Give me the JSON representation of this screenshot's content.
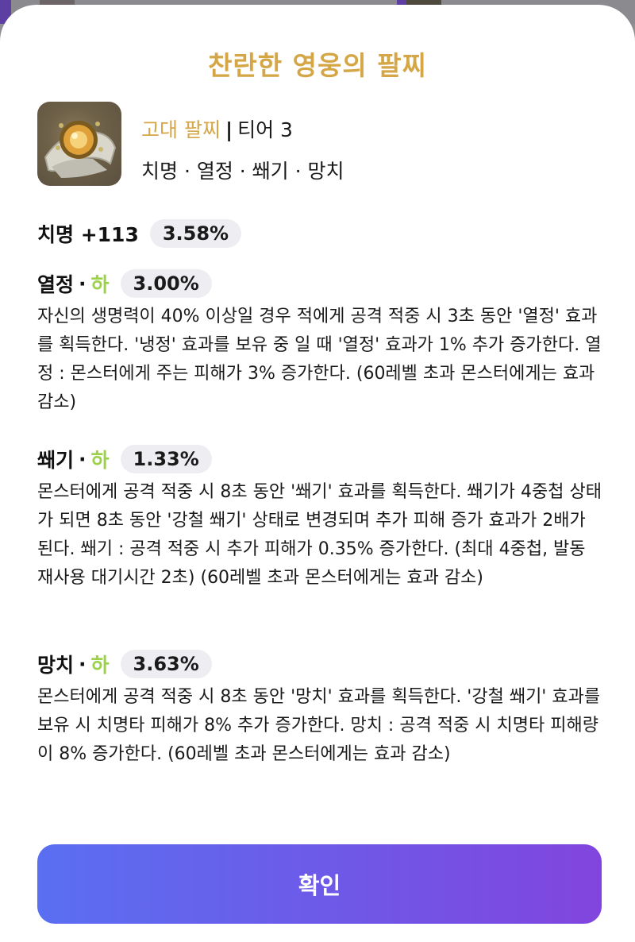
{
  "title": "찬란한 영웅의 팔찌",
  "item": {
    "grade": "고대 팔찌",
    "separator": "|",
    "tier": "티어 3",
    "tags": "치명 · 열정 · 쐐기 · 망치",
    "icon": "bracelet-icon"
  },
  "base_stat": {
    "name": "치명 +113",
    "percent": "3.58%"
  },
  "effects": [
    {
      "name": "열정",
      "dot": "·",
      "grade": "하",
      "percent": "3.00%",
      "description": "자신의 생명력이 40% 이상일 경우 적에게 공격 적중 시 3초 동안 '열정' 효과를 획득한다. '냉정' 효과를 보유 중 일 때 '열정' 효과가 1% 추가 증가한다. 열정 : 몬스터에게 주는 피해가 3% 증가한다. (60레벨 초과 몬스터에게는 효과 감소)"
    },
    {
      "name": "쐐기",
      "dot": "·",
      "grade": "하",
      "percent": "1.33%",
      "description": "몬스터에게 공격 적중 시 8초 동안 '쐐기' 효과를 획득한다. 쐐기가 4중첩 상태가 되면 8초 동안 '강철 쐐기' 상태로 변경되며 추가 피해 증가 효과가 2배가 된다. 쐐기 : 공격 적중 시 추가 피해가 0.35% 증가한다. (최대 4중첩, 발동 재사용 대기시간 2초) (60레벨 초과 몬스터에게는 효과 감소)"
    },
    {
      "name": "망치",
      "dot": "·",
      "grade": "하",
      "percent": "3.63%",
      "description": "몬스터에게 공격 적중 시 8초 동안 '망치' 효과를 획득한다. '강철 쐐기' 효과를 보유 시 치명타 피해가 8% 추가 증가한다. 망치 : 공격 적중 시 치명타 피해량이 8% 증가한다. (60레벨 초과 몬스터에게는 효과 감소)"
    }
  ],
  "confirm_label": "확인",
  "colors": {
    "title": "#d4a646",
    "grade_low": "#9bd24a",
    "button_start": "#5a6ff2",
    "button_end": "#8145dd"
  }
}
